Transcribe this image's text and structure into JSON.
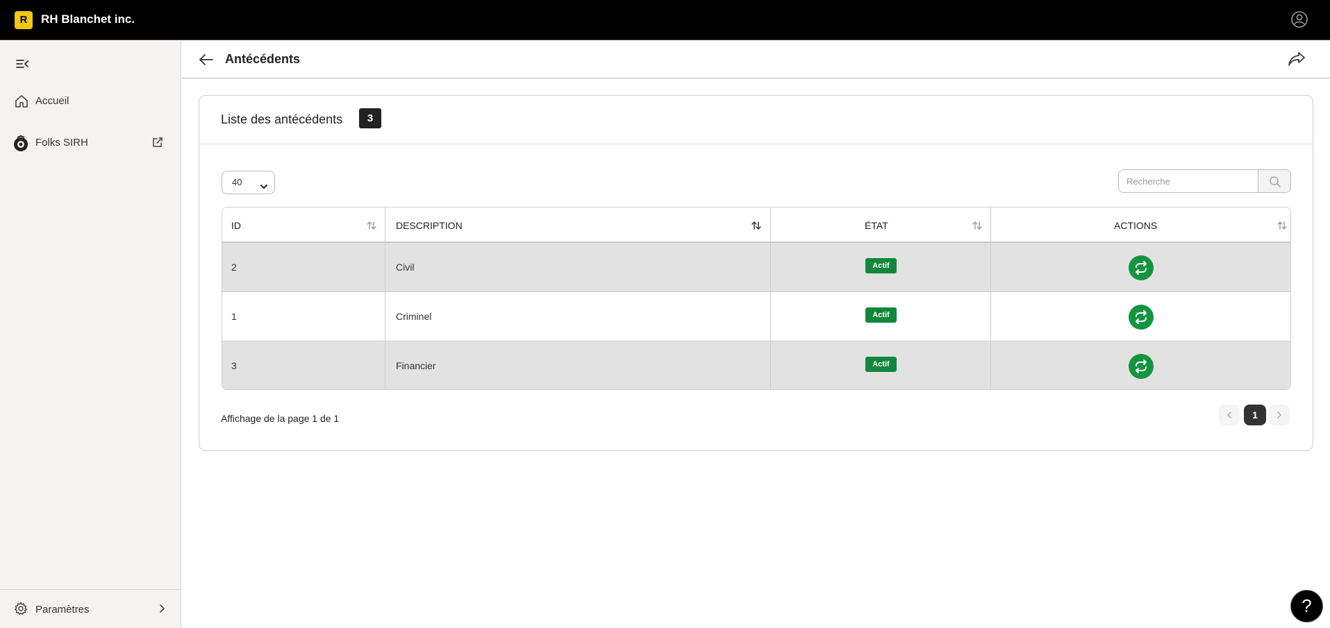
{
  "app": {
    "logo_letter": "R",
    "brand": "RH Blanchet inc."
  },
  "icons": {
    "user": "user-circle-icon",
    "collapse": "sidebar-collapse-icon",
    "home": "home-icon",
    "folks": "folks-logo-icon",
    "external": "external-link-icon",
    "settings": "gear-icon",
    "chevron": "chevron-right-icon",
    "back": "arrow-left-icon",
    "share": "share-icon",
    "search": "search-icon",
    "sort": "sort-icon",
    "refresh": "refresh-icon"
  },
  "sidebar": {
    "items": [
      {
        "label": "Accueil"
      },
      {
        "label": "Folks SIRH"
      }
    ],
    "footer": {
      "label": "Paramètres"
    }
  },
  "header": {
    "title": "Antécédents"
  },
  "card": {
    "title": "Liste des antécédents",
    "count": "3",
    "page_size": "40",
    "search_placeholder": "Recherche"
  },
  "table": {
    "columns": [
      "ID",
      "DESCRIPTION",
      "ÉTAT",
      "ACTIONS"
    ],
    "rows": [
      {
        "id": "2",
        "description": "Civil",
        "status": "Actif"
      },
      {
        "id": "1",
        "description": "Criminel",
        "status": "Actif"
      },
      {
        "id": "3",
        "description": "Financier",
        "status": "Actif"
      }
    ]
  },
  "pagination": {
    "info": "Affichage de la page 1 de 1",
    "current": "1"
  },
  "help": {
    "label": "?"
  },
  "colors": {
    "topbar": "#000000",
    "brand_accent": "#f5c518",
    "status_green": "#10873a",
    "action_green": "#13953f"
  }
}
